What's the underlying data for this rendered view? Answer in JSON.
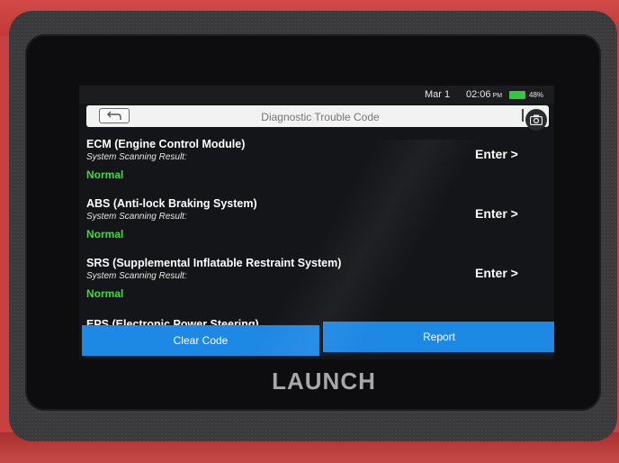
{
  "status": {
    "date": "Mar 1",
    "time": "02:06",
    "ampm": "PM",
    "battery": "48%",
    "battery_color": "#36c83c"
  },
  "header": {
    "title": "Diagnostic Trouble Code"
  },
  "modules": [
    {
      "name": "ECM (Engine Control Module)",
      "sub": "System Scanning Result:",
      "status": "Normal",
      "enter": "Enter >"
    },
    {
      "name": "ABS (Anti-lock Braking System)",
      "sub": "System Scanning Result:",
      "status": "Normal",
      "enter": "Enter >"
    },
    {
      "name": "SRS (Supplemental Inflatable Restraint System)",
      "sub": "System Scanning Result:",
      "status": "Normal",
      "enter": "Enter >"
    }
  ],
  "partial_module": "EPS (Electronic Power Steering)",
  "actions": {
    "clear": "Clear Code",
    "report": "Report"
  },
  "device": {
    "brand": "LAUNCH"
  },
  "colors": {
    "accent": "#1e88e5",
    "normal_status": "#3ddc3d",
    "screen_bg": "#141518"
  }
}
